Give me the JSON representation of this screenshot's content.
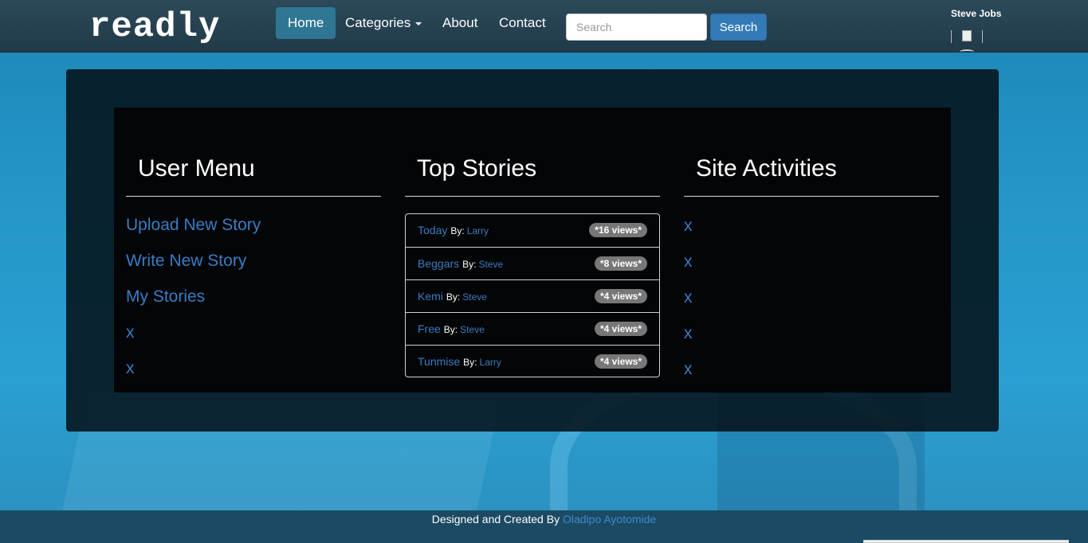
{
  "brand": "readly",
  "nav": {
    "home": "Home",
    "categories": "Categories",
    "about": "About",
    "contact": "Contact"
  },
  "search": {
    "placeholder": "Search",
    "button": "Search"
  },
  "user": {
    "name": "Steve Jobs"
  },
  "user_menu": {
    "heading": "User Menu",
    "items": [
      "Upload New Story",
      "Write New Story",
      "My Stories",
      "x",
      "x"
    ]
  },
  "top_stories": {
    "heading": "Top Stories",
    "by_label": "By:",
    "items": [
      {
        "title": "Today",
        "author": "Larry",
        "views": "*16 views*"
      },
      {
        "title": "Beggars",
        "author": "Steve",
        "views": "*8 views*"
      },
      {
        "title": "Kemi",
        "author": "Steve",
        "views": "*4 views*"
      },
      {
        "title": "Free",
        "author": "Steve",
        "views": "*4 views*"
      },
      {
        "title": "Tunmise",
        "author": "Larry",
        "views": "*4 views*"
      }
    ]
  },
  "site_activities": {
    "heading": "Site Activities",
    "items": [
      "x",
      "x",
      "x",
      "x",
      "x"
    ]
  },
  "footer": {
    "text": "Designed and Created By",
    "author_link": "Oladipo Ayotomide"
  },
  "colors": {
    "link": "#3a7cc4",
    "navbar": "#243f4d",
    "primary_button": "#337ab7",
    "badge": "#777777"
  }
}
